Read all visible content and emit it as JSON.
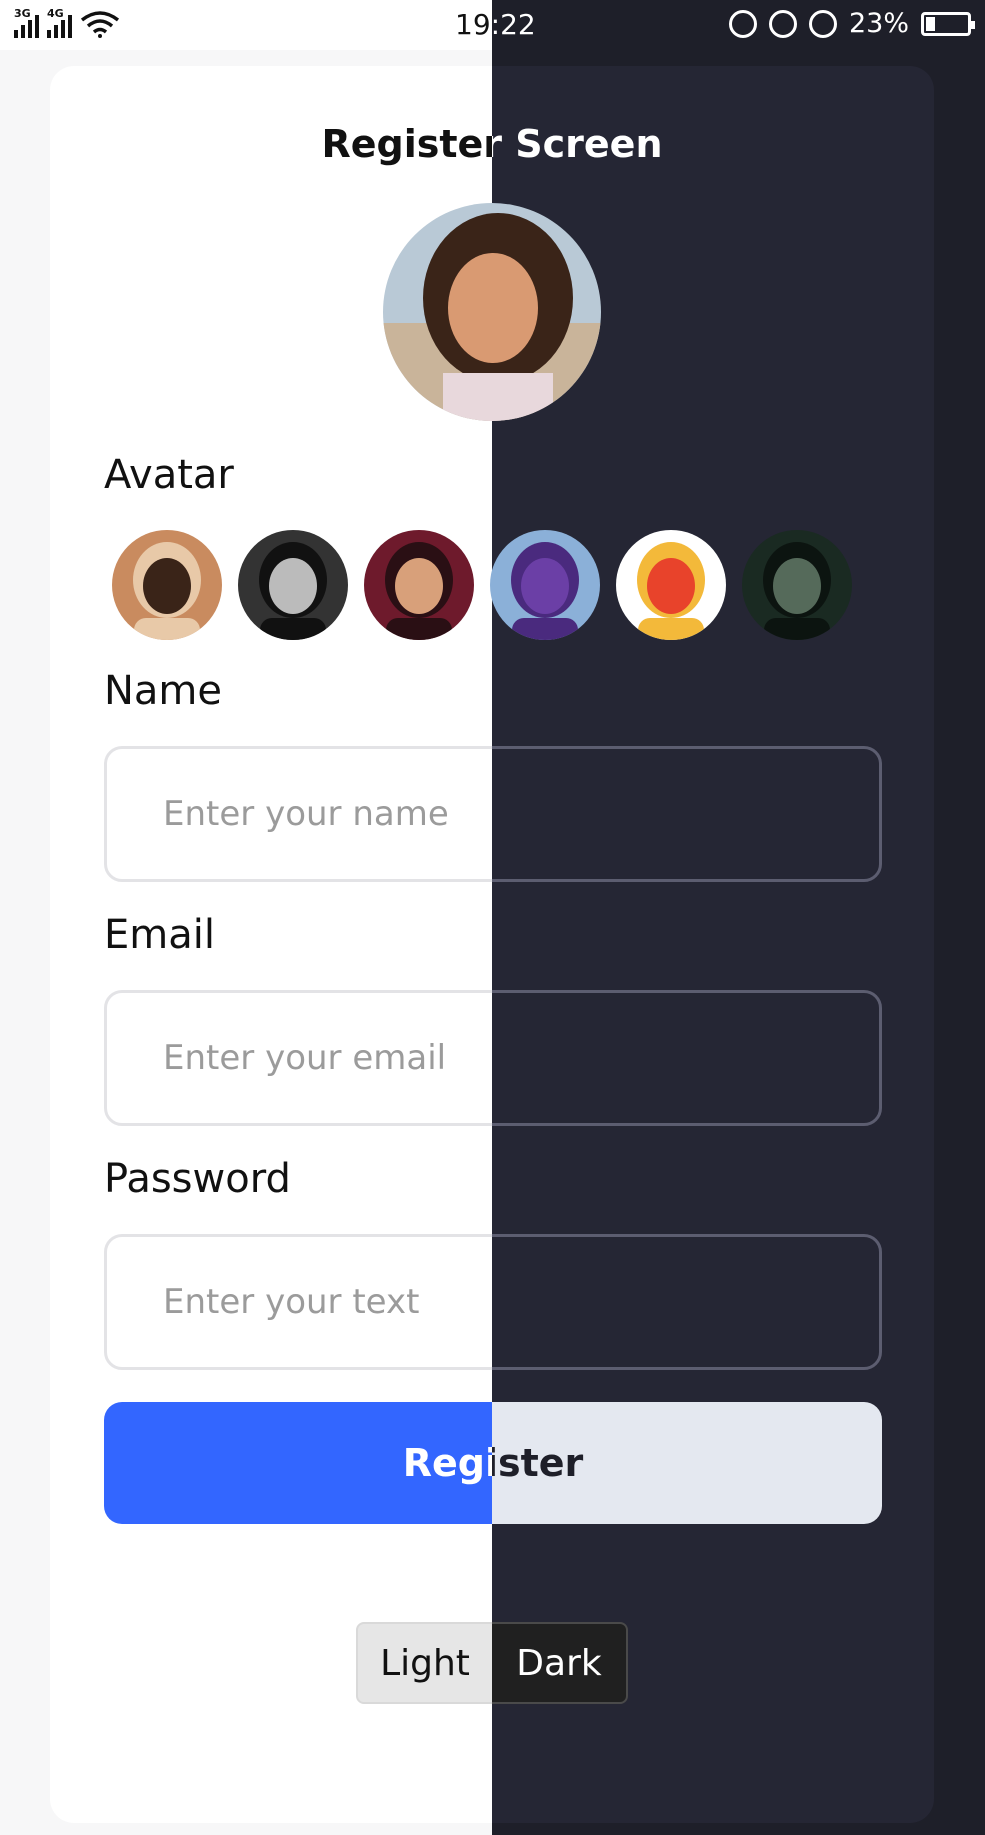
{
  "status_bar": {
    "signal_1_label": "3G",
    "signal_2_label": "4G",
    "time": "19:22",
    "battery_text": "23%",
    "battery_level": 0.23
  },
  "screen": {
    "title": "Register Screen"
  },
  "avatar_section": {
    "label": "Avatar",
    "main_avatar_icon": "woman-portrait-avatar",
    "options": [
      {
        "icon": "woman-portrait-avatar",
        "colors": [
          "#c98b5f",
          "#3a2418",
          "#e8c9a8"
        ]
      },
      {
        "icon": "man-smiling-bw-avatar",
        "colors": [
          "#333333",
          "#bbbbbb",
          "#111111"
        ]
      },
      {
        "icon": "man-dark-red-avatar",
        "colors": [
          "#6e1a2c",
          "#d8a07a",
          "#2a0f14"
        ]
      },
      {
        "icon": "teletubby-avatar",
        "colors": [
          "#8bb0d8",
          "#6b3fa6",
          "#4a2a7e"
        ]
      },
      {
        "icon": "anpanman-avatar",
        "colors": [
          "#ffffff",
          "#e8432b",
          "#f3b93a"
        ]
      },
      {
        "icon": "game-character-avatar",
        "colors": [
          "#1a2a22",
          "#556a5a",
          "#0c1410"
        ]
      }
    ]
  },
  "form": {
    "name_label": "Name",
    "name_placeholder": "Enter your name",
    "email_label": "Email",
    "email_placeholder": "Enter your email",
    "password_label": "Password",
    "password_placeholder": "Enter your text",
    "register_label": "Register"
  },
  "theme_toggle": {
    "light_label": "Light",
    "dark_label": "Dark"
  },
  "colors": {
    "primary_blue": "#3366ff",
    "dark_background": "#1e1f29",
    "dark_card": "#252634"
  }
}
